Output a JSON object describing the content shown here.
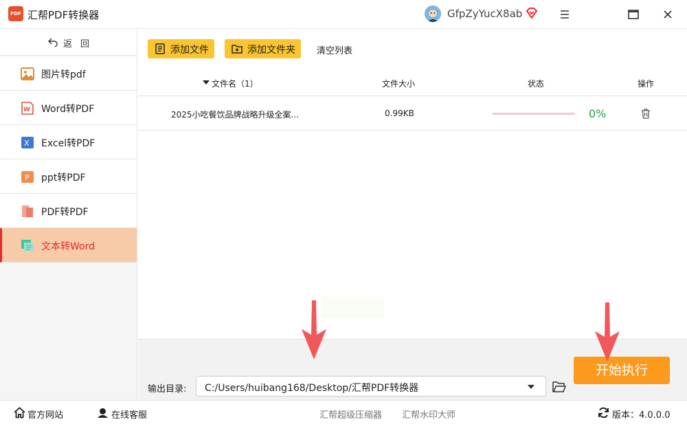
{
  "app": {
    "title": "汇帮PDF转换器",
    "logo_text": "PDF"
  },
  "user": {
    "name": "GfpZyYucX8ab"
  },
  "sidebar": {
    "back_label": "返回",
    "items": [
      {
        "label": "图片转pdf",
        "icon": "image-icon",
        "color": "#e08b3a"
      },
      {
        "label": "Word转PDF",
        "icon": "word-icon",
        "color": "#e55342"
      },
      {
        "label": "Excel转PDF",
        "icon": "excel-icon",
        "color": "#3d78d6"
      },
      {
        "label": "ppt转PDF",
        "icon": "ppt-icon",
        "color": "#f58c4a"
      },
      {
        "label": "PDF转PDF",
        "icon": "pdf-icon",
        "color": "#ee7b67"
      },
      {
        "label": "文本转Word",
        "icon": "text-icon",
        "color": "#3cc7a0",
        "active": true
      }
    ]
  },
  "toolbar": {
    "add_file": "添加文件",
    "add_folder": "添加文件夹",
    "clear_list": "清空列表"
  },
  "table": {
    "headers": {
      "name": "文件名（1）",
      "size": "文件大小",
      "status": "状态",
      "action": "操作"
    },
    "rows": [
      {
        "name": "2025小吃餐饮品牌战略升级全案...",
        "size": "0.99KB",
        "progress": 0,
        "percent": "0%"
      }
    ]
  },
  "output": {
    "label": "输出目录:",
    "path": "C:/Users/huibang168/Desktop/汇帮PDF转换器"
  },
  "start_button": "开始执行",
  "statusbar": {
    "website": "官方网站",
    "support": "在线客服",
    "compressor": "汇帮超级压缩器",
    "watermark": "汇帮水印大师",
    "version": "版本：4.0.0.0"
  },
  "colors": {
    "accent": "#fbc52f",
    "start": "#fb9a1c",
    "active_bg": "#f7cba8",
    "active_text": "#e52a2a",
    "success": "#1ea43a"
  }
}
